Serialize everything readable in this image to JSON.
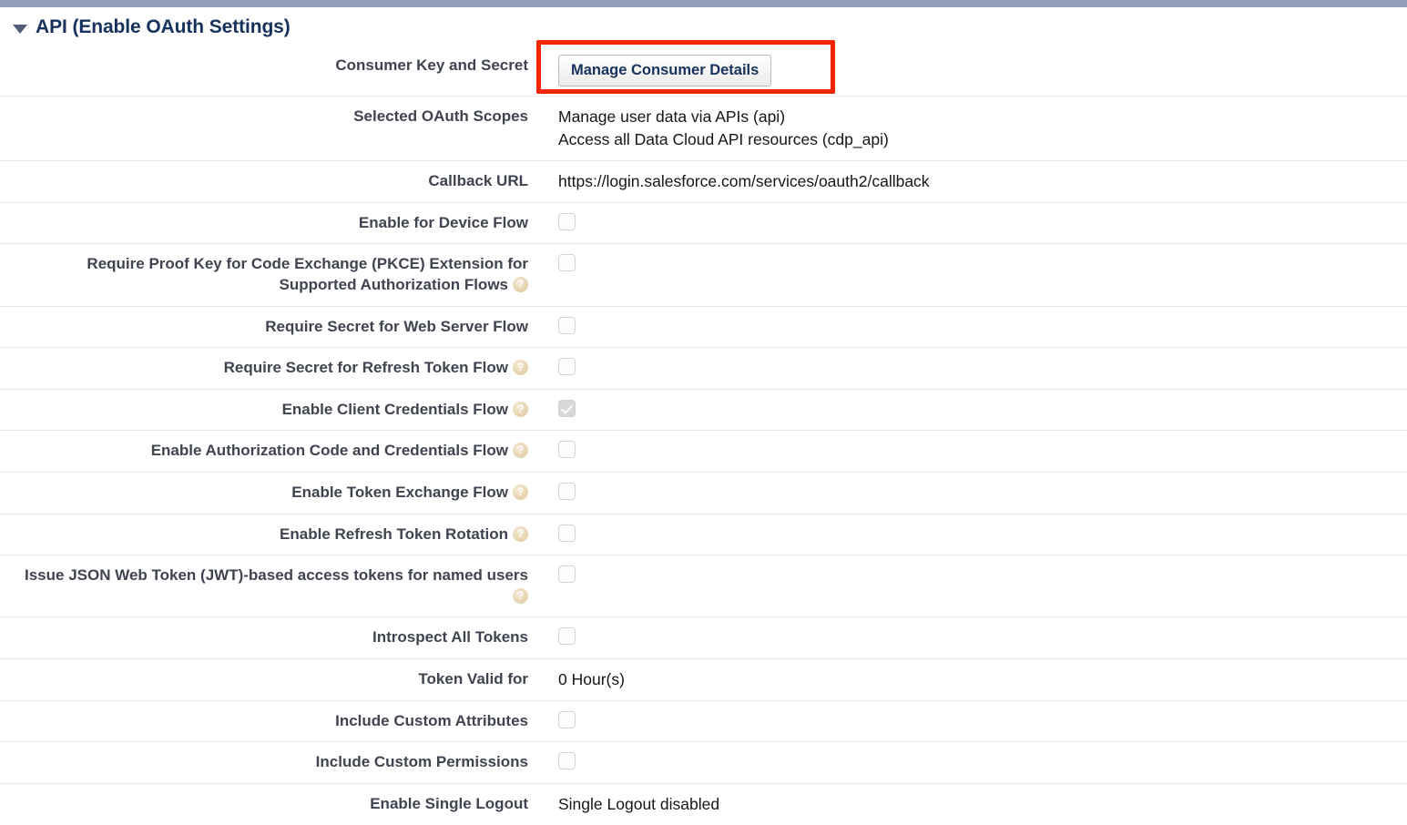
{
  "section": {
    "title": "API (Enable OAuth Settings)",
    "twisty_icon": "triangle-down-icon",
    "expanded": true
  },
  "annotation": {
    "highlight_color": "#f42400",
    "target": "Manage Consumer Details"
  },
  "theme": {
    "top_bar_color": "#959ebc",
    "label_color": "#3f4450",
    "title_color": "#16325c",
    "divider_color": "#e8e8e8",
    "help_icon_color": "#ead9b8"
  },
  "rows": [
    {
      "label": "Consumer Key and Secret",
      "type": "button",
      "button_label": "Manage Consumer Details",
      "help": false
    },
    {
      "label": "Selected OAuth Scopes",
      "type": "multiline-text",
      "values": [
        "Manage user data via APIs (api)",
        "Access all Data Cloud API resources (cdp_api)"
      ],
      "help": false
    },
    {
      "label": "Callback URL",
      "type": "text",
      "value": "https://login.salesforce.com/services/oauth2/callback",
      "help": false
    },
    {
      "label": "Enable for Device Flow",
      "type": "checkbox",
      "checked": false,
      "help": false
    },
    {
      "label": "Require Proof Key for Code Exchange (PKCE) Extension for Supported Authorization Flows",
      "type": "checkbox",
      "checked": false,
      "help": true
    },
    {
      "label": "Require Secret for Web Server Flow",
      "type": "checkbox",
      "checked": false,
      "help": false
    },
    {
      "label": "Require Secret for Refresh Token Flow",
      "type": "checkbox",
      "checked": false,
      "help": true
    },
    {
      "label": "Enable Client Credentials Flow",
      "type": "checkbox",
      "checked": true,
      "help": true
    },
    {
      "label": "Enable Authorization Code and Credentials Flow",
      "type": "checkbox",
      "checked": false,
      "help": true
    },
    {
      "label": "Enable Token Exchange Flow",
      "type": "checkbox",
      "checked": false,
      "help": true
    },
    {
      "label": "Enable Refresh Token Rotation",
      "type": "checkbox",
      "checked": false,
      "help": true
    },
    {
      "label": "Issue JSON Web Token (JWT)-based access tokens for named users",
      "type": "checkbox",
      "checked": false,
      "help": true
    },
    {
      "label": "Introspect All Tokens",
      "type": "checkbox",
      "checked": false,
      "help": false
    },
    {
      "label": "Token Valid for",
      "type": "text",
      "value": "0 Hour(s)",
      "help": false
    },
    {
      "label": "Include Custom Attributes",
      "type": "checkbox",
      "checked": false,
      "help": false
    },
    {
      "label": "Include Custom Permissions",
      "type": "checkbox",
      "checked": false,
      "help": false
    },
    {
      "label": "Enable Single Logout",
      "type": "text",
      "value": "Single Logout disabled",
      "help": false
    }
  ]
}
